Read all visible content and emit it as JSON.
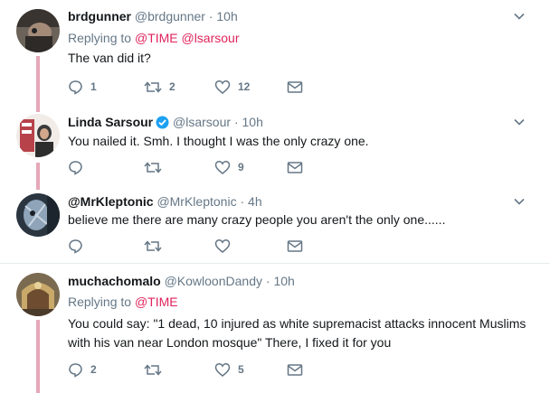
{
  "thread_color": "#e6a8b8",
  "accent_color": "#e0245e",
  "tweets": [
    {
      "name": "brdgunner",
      "handle": "@brdgunner",
      "time": "10h",
      "replying_label": "Replying to",
      "replying_mentions": [
        "@TIME",
        "@lsarsour"
      ],
      "text": "The van did it?",
      "replies": "1",
      "retweets": "2",
      "likes": "12"
    },
    {
      "name": "Linda Sarsour",
      "verified": true,
      "handle": "@lsarsour",
      "time": "10h",
      "text": "You nailed it. Smh. I thought I was the only crazy one.",
      "replies": "",
      "retweets": "",
      "likes": "9"
    },
    {
      "name": "@MrKleptonic",
      "handle": "@MrKleptonic",
      "time": "4h",
      "text": "believe me there are many crazy people you aren't the only one......",
      "replies": "",
      "retweets": "",
      "likes": ""
    },
    {
      "name": "muchachomalo",
      "handle": "@KowloonDandy",
      "time": "10h",
      "replying_label": "Replying to",
      "replying_mentions": [
        "@TIME"
      ],
      "text_lines": [
        "You could say: \"1 dead, 10 injured as white supremacist attacks innocent Muslims",
        "with his van near London mosque\"  There, I fixed it for you"
      ],
      "replies": "2",
      "retweets": "",
      "likes": "5"
    }
  ],
  "icons": [
    "reply-icon",
    "retweet-icon",
    "like-icon",
    "message-icon",
    "chevron-down-icon",
    "verified-icon"
  ]
}
